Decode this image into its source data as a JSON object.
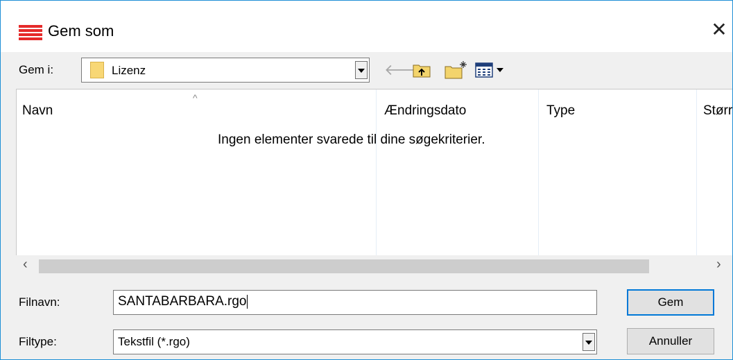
{
  "window": {
    "title": "Gem som",
    "close_glyph": "✕",
    "app_icon": "red-stripes-icon",
    "accent_color": "#1e8fd6"
  },
  "toolbar": {
    "lookin_label": "Gem i:",
    "lookin_value": "Lizenz",
    "icons": [
      "back-arrow-icon",
      "up-folder-icon",
      "new-folder-icon",
      "view-menu-icon"
    ]
  },
  "filelist": {
    "columns": [
      "Navn",
      "Ændringsdato",
      "Type",
      "Størrelse"
    ],
    "empty_message": "Ingen elementer svarede til dine søgekriterier."
  },
  "form": {
    "filename_label": "Filnavn:",
    "filename_value": "SANTABARBARA.rgo",
    "filetype_label": "Filtype:",
    "filetype_value": "Tekstfil (*.rgo)"
  },
  "buttons": {
    "save": "Gem",
    "cancel": "Annuller"
  }
}
